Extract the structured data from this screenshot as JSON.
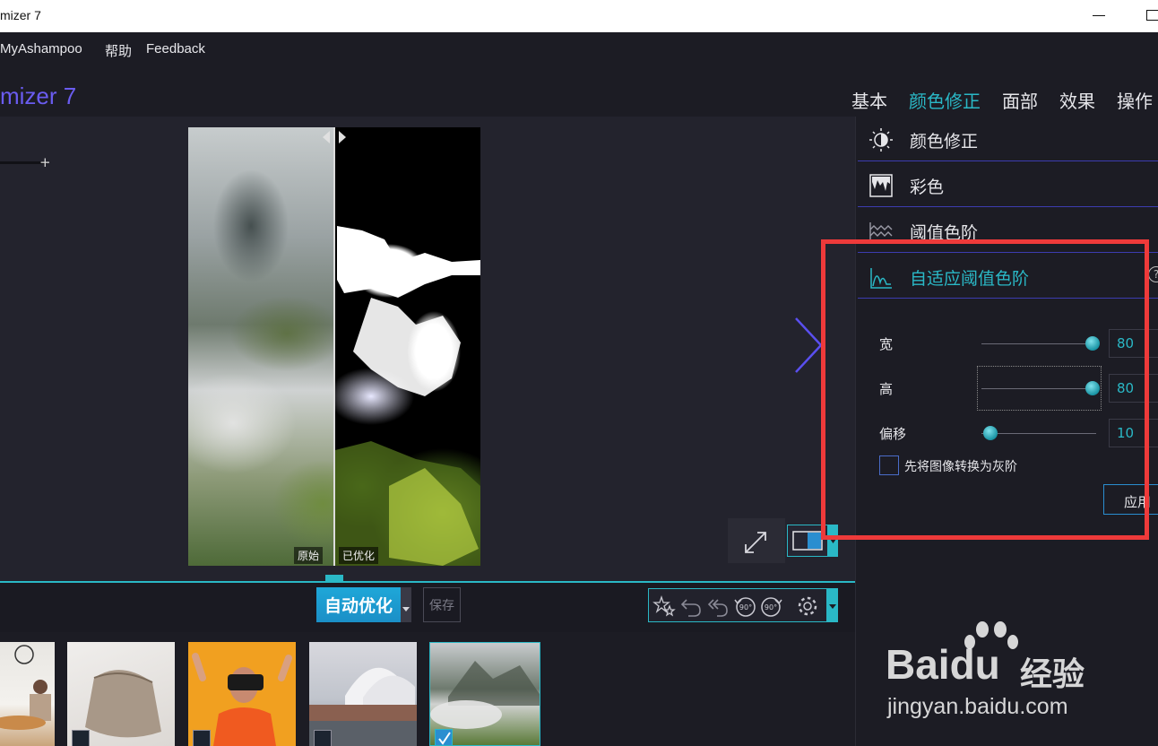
{
  "window": {
    "title": "mizer 7"
  },
  "menu": {
    "items": [
      "MyAshampoo",
      "帮助",
      "Feedback"
    ]
  },
  "app": {
    "title": "mizer 7"
  },
  "tabs": [
    {
      "label": "基本"
    },
    {
      "label": "颜色修正",
      "active": true
    },
    {
      "label": "面部"
    },
    {
      "label": "效果"
    },
    {
      "label": "操作"
    }
  ],
  "preview": {
    "original_label": "原始",
    "optimized_label": "已优化"
  },
  "toolbar": {
    "auto_label": "自动优化",
    "save_label": "保存"
  },
  "panel": {
    "sections": [
      {
        "label": "颜色修正",
        "icon": "brightness-icon"
      },
      {
        "label": "彩色",
        "icon": "color-drip-icon"
      },
      {
        "label": "阈值色阶",
        "icon": "wave-icon"
      },
      {
        "label": "自适应阈值色阶",
        "icon": "curve-icon",
        "active": true
      }
    ],
    "params": [
      {
        "label": "宽",
        "value": "80",
        "level": 1.0
      },
      {
        "label": "高",
        "value": "80",
        "level": 1.0
      },
      {
        "label": "偏移",
        "value": "10",
        "level": 0.0
      }
    ],
    "grayscale_label": "先将图像转换为灰阶",
    "grayscale_checked": false,
    "apply_label": "应用"
  },
  "filmstrip": {
    "thumbs": [
      {
        "name": "dining",
        "checked": false
      },
      {
        "name": "pouch",
        "checked": false
      },
      {
        "name": "vr",
        "checked": false
      },
      {
        "name": "opera-house",
        "checked": false
      },
      {
        "name": "mountains",
        "checked": true
      }
    ]
  },
  "watermark": {
    "logo": "Baidu",
    "cn": "经验",
    "url": "jingyan.baidu.com"
  },
  "colors": {
    "accent": "#2ab8c6",
    "brand": "#6a5cf0",
    "highlight": "#ee3a3a"
  }
}
